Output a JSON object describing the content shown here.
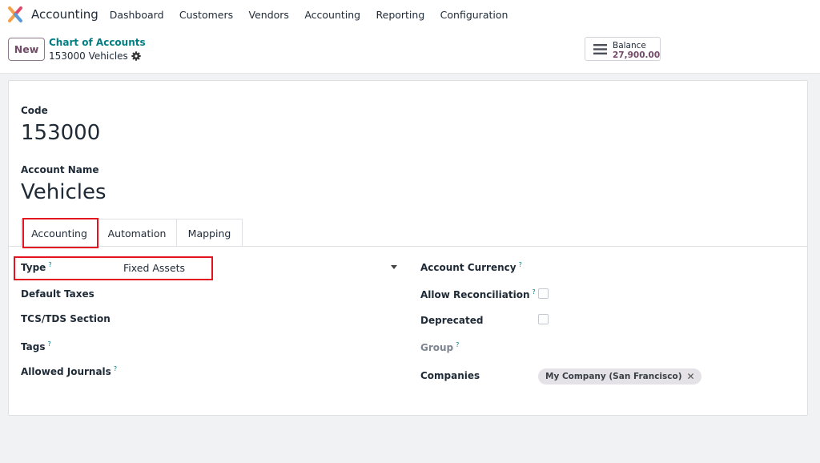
{
  "app": {
    "title": "Accounting"
  },
  "menu": [
    "Dashboard",
    "Customers",
    "Vendors",
    "Accounting",
    "Reporting",
    "Configuration"
  ],
  "control": {
    "new_label": "New",
    "breadcrumb_parent": "Chart of Accounts",
    "breadcrumb_current": "153000 Vehicles",
    "balance_label": "Balance",
    "balance_value": "27,900.00"
  },
  "form": {
    "code_label": "Code",
    "code_value": "153000",
    "name_label": "Account Name",
    "name_value": "Vehicles",
    "tabs": [
      "Accounting",
      "Automation",
      "Mapping"
    ],
    "active_tab": "Accounting",
    "left_fields": {
      "type_label": "Type",
      "type_value": "Fixed Assets",
      "default_taxes_label": "Default Taxes",
      "tcs_label": "TCS/TDS Section",
      "tags_label": "Tags",
      "journals_label": "Allowed Journals"
    },
    "right_fields": {
      "currency_label": "Account Currency",
      "reconcile_label": "Allow Reconciliation",
      "reconcile_checked": false,
      "deprecated_label": "Deprecated",
      "deprecated_checked": false,
      "group_label": "Group",
      "companies_label": "Companies",
      "company_tag": "My Company (San Francisco)"
    },
    "help_mark": "?"
  },
  "colors": {
    "brand": "#714b67",
    "link": "#017e84",
    "highlight": "#e3141f"
  }
}
